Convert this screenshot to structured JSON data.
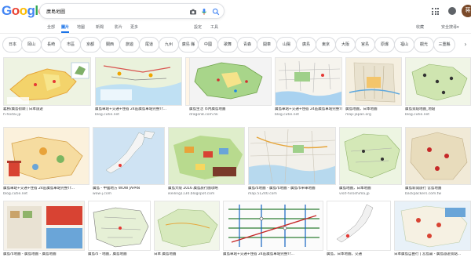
{
  "header": {
    "logo_letters": [
      "G",
      "o",
      "o",
      "g",
      "l",
      "e"
    ],
    "search_value": "廣島地圖",
    "icons": [
      "camera-icon",
      "microphone-icon",
      "search-icon",
      "apps-icon",
      "notifications-icon"
    ],
    "avatar_initial": "蒋"
  },
  "tabs": {
    "items": [
      "全部",
      "圖片",
      "地圖",
      "新聞",
      "影片",
      "更多"
    ],
    "active": "圖片",
    "settings": "設定",
    "tools": "工具",
    "collections": "收藏",
    "safesearch": "安全搜尋▾"
  },
  "chips": [
    "日本",
    "岡山",
    "長崎",
    "市區",
    "京都",
    "關西",
    "旅遊",
    "尾道",
    "九州",
    "廣島 縣",
    "中國",
    "歌舞",
    "青森",
    "開車",
    "山陽",
    "廣島",
    "東京",
    "大阪",
    "宮島",
    "原爆",
    "福山",
    "觀光",
    "三重縣",
    "市平"
  ],
  "results": [
    {
      "caption": "義務/廣島街頭 | 日本旅遊",
      "source": "h-hodai.jp"
    },
    {
      "caption": "廣島車站+交通+住宿 24區廣島車站完整介...",
      "source": "blog.cutie.net"
    },
    {
      "caption": "廣島車站+交通+住宿 24區廣島車站...",
      "source": "blog.cutie.net"
    },
    {
      "caption": "廣島生活 市內廣島地圖",
      "source": "dragon8.com.hk"
    },
    {
      "caption": "廣島車站+交通+住宿 24區廣島車站完整介...",
      "source": "blog.cutie.net"
    },
    {
      "caption": "廣島地圖，日本地圖",
      "source": "map-japan.org"
    },
    {
      "caption": "廣島景點地圖_地點",
      "source": "blog.cutie.net"
    },
    {
      "caption": "廣島車站+交通+住宿 24區廣島車站完整介...",
      "source": "blog.cutie.net"
    },
    {
      "caption": "廣島 - 中國地方 WOW JAPAN",
      "source": "wow-j.com"
    },
    {
      "caption": "廣島大阪 2016 廣島旅行圖攻略",
      "source": "ikeiling1130.blogspot.com"
    },
    {
      "caption": "廣島市地圖 - 廣島市地圖 - 廣島市單車地圖",
      "source": "map.51240.com"
    },
    {
      "caption": "廣島地圖，日本地圖",
      "source": "visit-hiroshima.jp"
    },
    {
      "caption": "廣島新開旅行 宮島地圖",
      "source": "backpackers.com.tw"
    },
    {
      "caption": "廣島市地圖 - 廣島地圖 - 廣島地圖",
      "source": "clickme.com"
    },
    {
      "caption": "廣島市 - 地圖，廣島地圖",
      "source": "map.jp"
    },
    {
      "caption": "日本 廣島地圖",
      "source": "dragon8.com"
    },
    {
      "caption": "廣島車站+交通+住宿 24區廣島車站完整介...",
      "source": "blog.cutie.net"
    },
    {
      "caption": "廣島，日本地圖，交通",
      "source": "japan-guide.com"
    },
    {
      "caption": "日本一 - 第一個「中國」+ 這...",
      "source": "visit-japan.jp"
    },
    {
      "caption": "日本廣島自由行 | 宮島篇 - 廣島旅遊景點...",
      "source": "blog.cutie.net"
    }
  ],
  "colors": {
    "accent": "#1a73e8",
    "map_green": "#cde3b5",
    "map_yellow": "#f3d36b",
    "water": "#a9d2f0"
  }
}
